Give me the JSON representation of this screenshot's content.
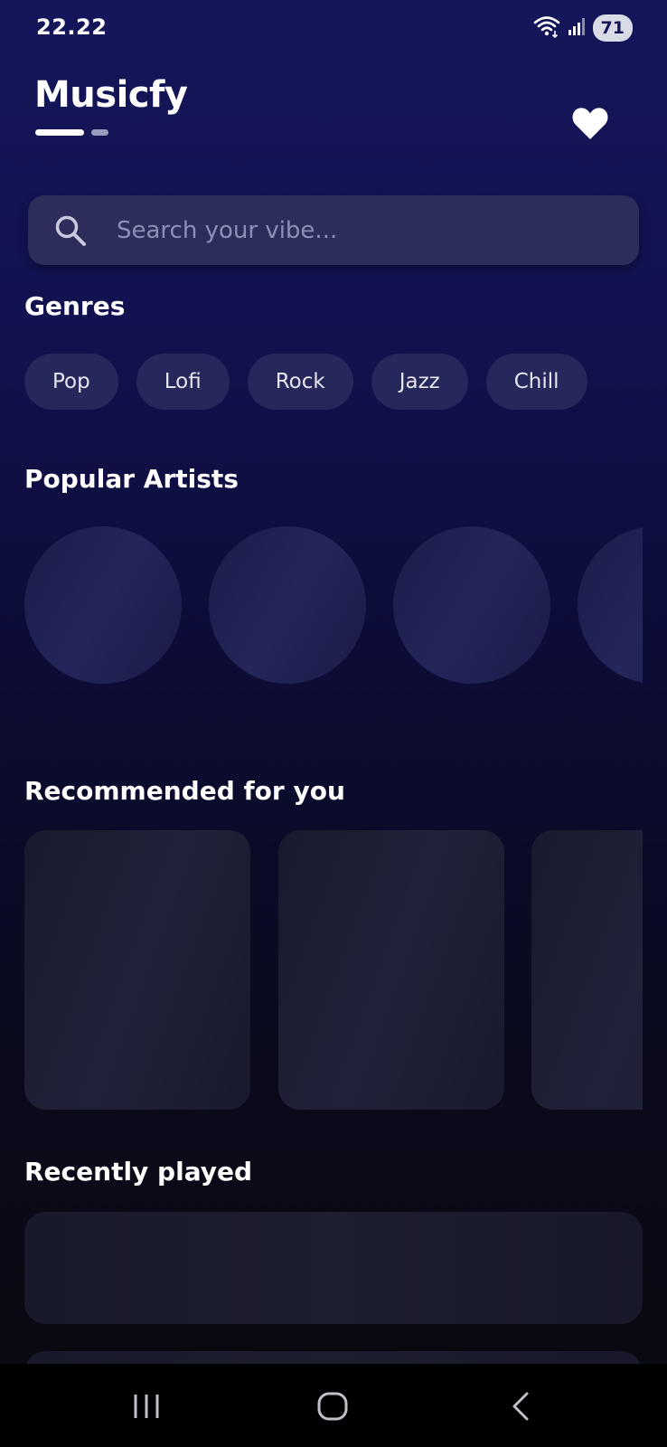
{
  "status_bar": {
    "time": "22.22",
    "battery": "71",
    "icons": [
      "wifi-icon",
      "signal-icon",
      "battery-icon"
    ]
  },
  "header": {
    "app_title": "Musicfy",
    "favorites_icon": "heart-icon"
  },
  "search": {
    "placeholder": "Search your vibe...",
    "value": "",
    "icon": "search-icon"
  },
  "genres": {
    "title": "Genres",
    "items": [
      "Pop",
      "Lofi",
      "Rock",
      "Jazz",
      "Chill"
    ]
  },
  "popular_artists": {
    "title": "Popular Artists"
  },
  "recommended": {
    "title": "Recommended for you"
  },
  "recently_played": {
    "title": "Recently played"
  },
  "nav_bar": {
    "icons": [
      "recent-apps-icon",
      "home-icon",
      "back-icon"
    ]
  },
  "colors": {
    "background_top": "#15165a",
    "background_bottom": "#09090f",
    "search_bg": "#2c2d5a",
    "chip_bg": "#26275a",
    "placeholder": "#8d8fb6"
  }
}
